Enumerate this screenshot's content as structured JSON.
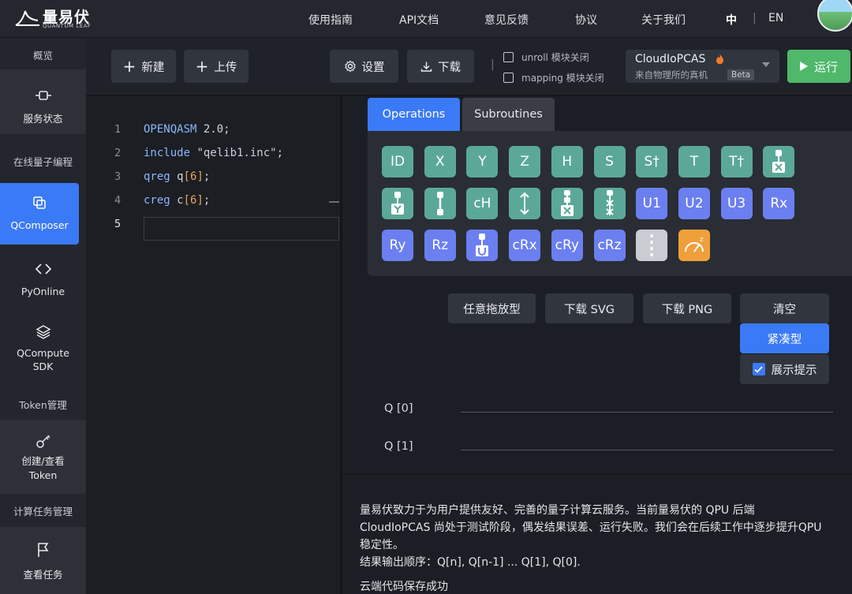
{
  "brand": {
    "name": "量易伏",
    "sub": "QUANTUM LEAF"
  },
  "nav": {
    "items": [
      "使用指南",
      "API文档",
      "意见反馈",
      "协议",
      "关于我们"
    ],
    "lang_zh": "中",
    "lang_sep": "|",
    "lang_en": "EN"
  },
  "sidebar": {
    "overview": "概览",
    "service_status": "服务状态",
    "online_programming": "在线量子编程",
    "qcomposer": "QComposer",
    "pyonline": "PyOnline",
    "qcompute_sdk_line1": "QCompute",
    "qcompute_sdk_line2": "SDK",
    "token_mgmt": "Token管理",
    "token_create_line1": "创建/查看",
    "token_create_line2": "Token",
    "task_mgmt": "计算任务管理",
    "view_tasks": "查看任务"
  },
  "toolbar": {
    "new": "新建",
    "upload": "上传",
    "settings": "设置",
    "download": "下载",
    "sep": "|",
    "unroll": "unroll 模块关闭",
    "mapping": "mapping 模块关闭",
    "device_name": "CloudIoPCAS",
    "device_sub": "来自物理所的真机",
    "device_badge": "Beta",
    "run": "运行"
  },
  "editor": {
    "lines": [
      {
        "n": "1",
        "tokens": [
          {
            "t": "OPENQASM ",
            "c": "kw"
          },
          {
            "t": "2.0;",
            "c": ""
          }
        ]
      },
      {
        "n": "2",
        "tokens": [
          {
            "t": "include ",
            "c": "kw"
          },
          {
            "t": "\"qelib1.inc\"",
            "c": "str"
          },
          {
            "t": ";",
            "c": ""
          }
        ]
      },
      {
        "n": "3",
        "tokens": [
          {
            "t": "qreg ",
            "c": "kw"
          },
          {
            "t": "q",
            "c": ""
          },
          {
            "t": "[6]",
            "c": "num"
          },
          {
            "t": ";",
            "c": ""
          }
        ]
      },
      {
        "n": "4",
        "tokens": [
          {
            "t": "creg ",
            "c": "kw"
          },
          {
            "t": "c",
            "c": ""
          },
          {
            "t": "[6]",
            "c": "num"
          },
          {
            "t": ";",
            "c": ""
          }
        ]
      },
      {
        "n": "5",
        "tokens": []
      }
    ]
  },
  "palette": {
    "tab_operations": "Operations",
    "tab_subroutines": "Subroutines",
    "rows": [
      [
        {
          "l": "ID",
          "c": "teal"
        },
        {
          "l": "X",
          "c": "teal"
        },
        {
          "l": "Y",
          "c": "teal"
        },
        {
          "l": "Z",
          "c": "teal"
        },
        {
          "l": "H",
          "c": "teal"
        },
        {
          "l": "S",
          "c": "teal"
        },
        {
          "l": "S†",
          "c": "teal"
        },
        {
          "l": "T",
          "c": "teal"
        },
        {
          "l": "T†",
          "c": "teal"
        },
        {
          "l": "",
          "c": "teal",
          "icon": "ctrl-x"
        }
      ],
      [
        {
          "l": "",
          "c": "teal",
          "icon": "ctrl-y"
        },
        {
          "l": "",
          "c": "teal",
          "icon": "ctrl-link"
        },
        {
          "l": "cH",
          "c": "teal"
        },
        {
          "l": "",
          "c": "teal",
          "icon": "swap-arrow"
        },
        {
          "l": "",
          "c": "teal",
          "icon": "toffoli"
        },
        {
          "l": "",
          "c": "teal",
          "icon": "cswap"
        },
        {
          "l": "U1",
          "c": "blue"
        },
        {
          "l": "U2",
          "c": "blue"
        },
        {
          "l": "U3",
          "c": "blue"
        },
        {
          "l": "Rx",
          "c": "blue"
        }
      ],
      [
        {
          "l": "Ry",
          "c": "blue"
        },
        {
          "l": "Rz",
          "c": "blue"
        },
        {
          "l": "",
          "c": "blue",
          "icon": "ctrl-u"
        },
        {
          "l": "cRx",
          "c": "blue"
        },
        {
          "l": "cRy",
          "c": "blue"
        },
        {
          "l": "cRz",
          "c": "blue"
        },
        {
          "l": "",
          "c": "gray",
          "icon": "barrier"
        },
        {
          "l": "",
          "c": "orange",
          "icon": "measure"
        }
      ]
    ]
  },
  "actions": {
    "drag": "任意拖放型",
    "svg": "下载 SVG",
    "png": "下载 PNG",
    "clear": "清空",
    "compact": "紧凑型",
    "hints": "展示提示"
  },
  "circuit": {
    "qubits": [
      "Q [0]",
      "Q [1]"
    ]
  },
  "output": {
    "line1": "量易伏致力于为用户提供友好、完善的量子计算云服务。当前量易伏的 QPU 后端",
    "line2": "CloudIoPCAS 尚处于测试阶段，偶发结果误差、运行失败。我们会在后续工作中逐步提升QPU",
    "line3": "稳定性。",
    "line4": "结果输出顺序：Q[n], Q[n-1] ... Q[1], Q[0].",
    "line5": "云端代码保存成功"
  },
  "colors": {
    "accent": "#3b7af6",
    "run_green": "#4fb86b",
    "gate_teal": "#5ba899",
    "gate_blue": "#6b7ff0",
    "measure_orange": "#f0a03a"
  }
}
